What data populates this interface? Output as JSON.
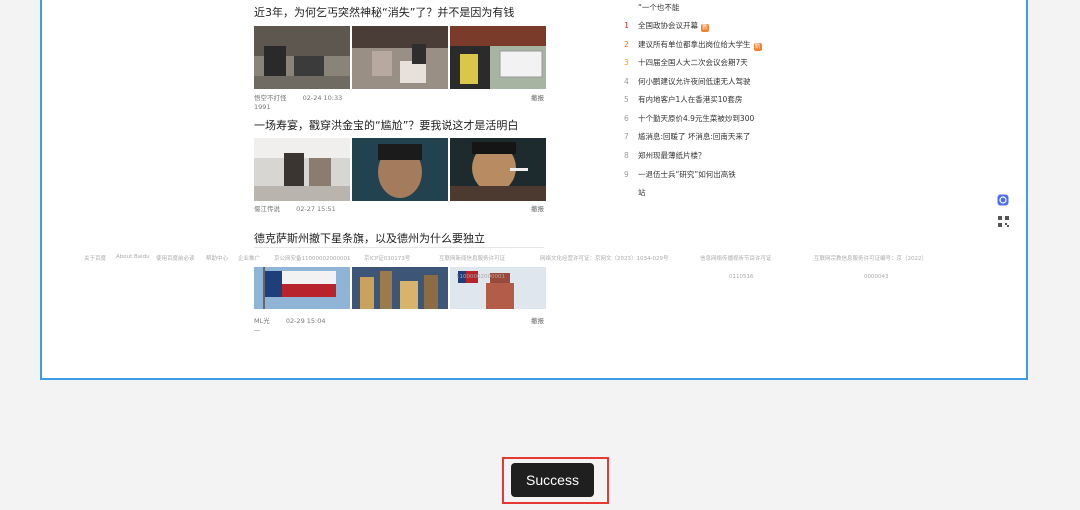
{
  "articles": [
    {
      "title": "近3年，为何乞丐突然神秘“消失”了？并不是因为有钱",
      "author": "悟空不打怪",
      "time": "02-24 10:33",
      "report": "撤报",
      "extra": "1991"
    },
    {
      "title": "一场寿宴，戳穿洪金宝的“尴尬”？要我说这才是活明白",
      "author": "偃江传说",
      "time": "02-27 15:51",
      "report": "撤报"
    },
    {
      "title": "德克萨斯州撤下星条旗，以及德州为什么要独立",
      "author": "ML光",
      "time": "02-29 15:04",
      "report": "撤报",
      "extra": "—"
    }
  ],
  "hotlist": {
    "top_text": "“一个也不能",
    "items": [
      {
        "rank": "1",
        "text": "全国政协会议开幕",
        "tag": "新"
      },
      {
        "rank": "2",
        "text": "建议所有单位都拿出岗位给大学生",
        "tag": "新"
      },
      {
        "rank": "3",
        "text": "十四届全国人大二次会议会期7天"
      },
      {
        "rank": "4",
        "text": "何小鹏建议允许夜间低速无人驾驶"
      },
      {
        "rank": "5",
        "text": "有内地客户1人在香港买10套房"
      },
      {
        "rank": "6",
        "text": "十个勤天原价4.9元生菜被炒到300"
      },
      {
        "rank": "7",
        "text": "尴消息:回暖了 坏消息:回南天来了"
      },
      {
        "rank": "8",
        "text": "郑州现最薄纸片楼？"
      },
      {
        "rank": "9",
        "text": "一退伍士兵“研究”如何出高铁"
      }
    ],
    "wrap_text": "站"
  },
  "footer": {
    "items": [
      "关于百度",
      "About Baidu",
      "使用百度前必读",
      "帮助中心",
      "企业推广",
      "京公网安备11000002000001",
      "京ICP证030173号",
      "互联网新闻信息服务许可证",
      "网络文化经营许可证：京网文（2023）1034-029号",
      "信息网络传播视听节目许可证",
      "互联网宗教信息服务许可证编号：京（2022）"
    ],
    "line2": [
      "11000002000001",
      "0110516",
      "0000043"
    ]
  },
  "toast": {
    "label": "Success"
  },
  "colors": {
    "frame_border": "#3c9ee5",
    "toast_bg": "#1f1f1f",
    "highlight_red": "#e53935"
  }
}
